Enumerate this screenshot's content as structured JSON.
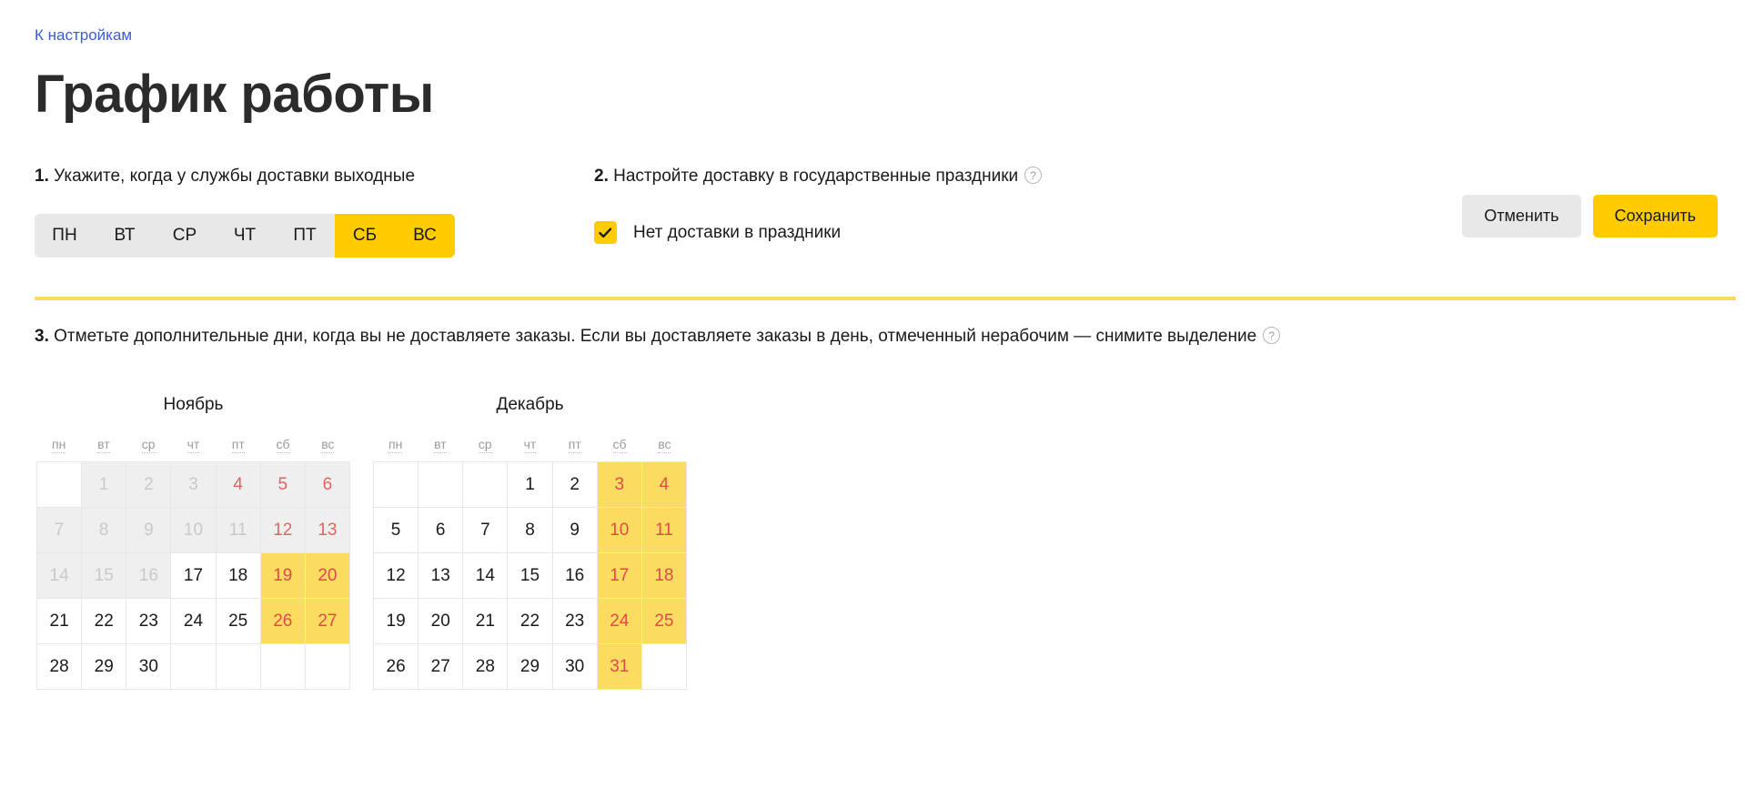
{
  "back_link": "К настройкам",
  "title": "График работы",
  "step1": {
    "num": "1.",
    "label": " Укажите, когда у службы доставки выходные",
    "weekdays": [
      {
        "label": "ПН",
        "selected": false
      },
      {
        "label": "ВТ",
        "selected": false
      },
      {
        "label": "СР",
        "selected": false
      },
      {
        "label": "ЧТ",
        "selected": false
      },
      {
        "label": "ПТ",
        "selected": false
      },
      {
        "label": "СБ",
        "selected": true
      },
      {
        "label": "ВС",
        "selected": true
      }
    ]
  },
  "step2": {
    "num": "2.",
    "label": " Настройте доставку в государственные праздники",
    "help_icon": "question-mark-icon",
    "checkbox": {
      "label": "Нет доставки в праздники",
      "checked": true
    }
  },
  "step3": {
    "num": "3.",
    "label": " Отметьте дополнительные дни, когда вы не доставляете заказы. Если вы доставляете заказы в день, отмеченный нерабочим — снимите выделение",
    "help_icon": "question-mark-icon"
  },
  "actions": {
    "cancel": "Отменить",
    "save": "Сохранить"
  },
  "colors": {
    "accent_yellow": "#ffcc00",
    "calendar_yellow": "#fbdc60",
    "divider_yellow": "#fbdb5f",
    "link_blue": "#3b5bdb",
    "weekend_red": "#e04a4a",
    "disabled_gray": "#c9c9c9",
    "button_gray": "#e8e8e8"
  },
  "calendars": [
    {
      "month": "Ноябрь",
      "weekday_headers": [
        "пн",
        "вт",
        "ср",
        "чт",
        "пт",
        "сб",
        "вс"
      ],
      "cells": [
        {
          "day": "",
          "state": "empty"
        },
        {
          "day": "1",
          "state": "past"
        },
        {
          "day": "2",
          "state": "past"
        },
        {
          "day": "3",
          "state": "past"
        },
        {
          "day": "4",
          "state": "past-weekend"
        },
        {
          "day": "5",
          "state": "past-weekend"
        },
        {
          "day": "6",
          "state": "past-weekend"
        },
        {
          "day": "7",
          "state": "past"
        },
        {
          "day": "8",
          "state": "past"
        },
        {
          "day": "9",
          "state": "past"
        },
        {
          "day": "10",
          "state": "past"
        },
        {
          "day": "11",
          "state": "past"
        },
        {
          "day": "12",
          "state": "past-weekend"
        },
        {
          "day": "13",
          "state": "past-weekend"
        },
        {
          "day": "14",
          "state": "past"
        },
        {
          "day": "15",
          "state": "past"
        },
        {
          "day": "16",
          "state": "past"
        },
        {
          "day": "17",
          "state": "normal"
        },
        {
          "day": "18",
          "state": "normal"
        },
        {
          "day": "19",
          "state": "selected"
        },
        {
          "day": "20",
          "state": "selected"
        },
        {
          "day": "21",
          "state": "normal"
        },
        {
          "day": "22",
          "state": "normal"
        },
        {
          "day": "23",
          "state": "normal"
        },
        {
          "day": "24",
          "state": "normal"
        },
        {
          "day": "25",
          "state": "normal"
        },
        {
          "day": "26",
          "state": "selected"
        },
        {
          "day": "27",
          "state": "selected"
        },
        {
          "day": "28",
          "state": "normal"
        },
        {
          "day": "29",
          "state": "normal"
        },
        {
          "day": "30",
          "state": "normal"
        },
        {
          "day": "",
          "state": "empty"
        },
        {
          "day": "",
          "state": "empty"
        },
        {
          "day": "",
          "state": "empty"
        },
        {
          "day": "",
          "state": "empty"
        }
      ]
    },
    {
      "month": "Декабрь",
      "weekday_headers": [
        "пн",
        "вт",
        "ср",
        "чт",
        "пт",
        "сб",
        "вс"
      ],
      "cells": [
        {
          "day": "",
          "state": "empty"
        },
        {
          "day": "",
          "state": "empty"
        },
        {
          "day": "",
          "state": "empty"
        },
        {
          "day": "1",
          "state": "normal"
        },
        {
          "day": "2",
          "state": "normal"
        },
        {
          "day": "3",
          "state": "selected"
        },
        {
          "day": "4",
          "state": "selected"
        },
        {
          "day": "5",
          "state": "normal"
        },
        {
          "day": "6",
          "state": "normal"
        },
        {
          "day": "7",
          "state": "normal"
        },
        {
          "day": "8",
          "state": "normal"
        },
        {
          "day": "9",
          "state": "normal"
        },
        {
          "day": "10",
          "state": "selected"
        },
        {
          "day": "11",
          "state": "selected"
        },
        {
          "day": "12",
          "state": "normal"
        },
        {
          "day": "13",
          "state": "normal"
        },
        {
          "day": "14",
          "state": "normal"
        },
        {
          "day": "15",
          "state": "normal"
        },
        {
          "day": "16",
          "state": "normal"
        },
        {
          "day": "17",
          "state": "selected"
        },
        {
          "day": "18",
          "state": "selected"
        },
        {
          "day": "19",
          "state": "normal"
        },
        {
          "day": "20",
          "state": "normal"
        },
        {
          "day": "21",
          "state": "normal"
        },
        {
          "day": "22",
          "state": "normal"
        },
        {
          "day": "23",
          "state": "normal"
        },
        {
          "day": "24",
          "state": "selected"
        },
        {
          "day": "25",
          "state": "selected"
        },
        {
          "day": "26",
          "state": "normal"
        },
        {
          "day": "27",
          "state": "normal"
        },
        {
          "day": "28",
          "state": "normal"
        },
        {
          "day": "29",
          "state": "normal"
        },
        {
          "day": "30",
          "state": "normal"
        },
        {
          "day": "31",
          "state": "selected"
        },
        {
          "day": "",
          "state": "empty"
        }
      ]
    }
  ]
}
